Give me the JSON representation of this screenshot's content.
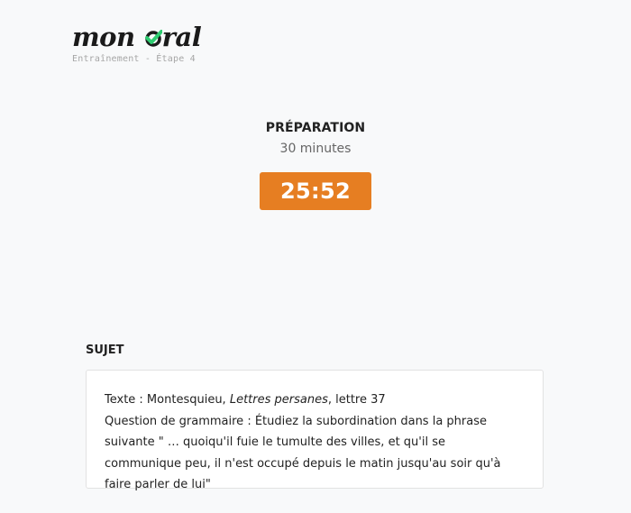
{
  "logo": {
    "word1": "mon",
    "word2_after_check": "ral",
    "check_color": "#2ecc71"
  },
  "header": {
    "subtitle": "Entraînement - Étape 4"
  },
  "timer_section": {
    "phase_title": "PRÉPARATION",
    "phase_duration": "30 minutes",
    "countdown": "25:52",
    "accent_color": "#e67e22"
  },
  "subject": {
    "heading": "SUJET",
    "text_prefix": "Texte : Montesquieu, ",
    "text_work": "Lettres persanes",
    "text_suffix": ", lettre 37",
    "question": "Question de grammaire : Étudiez la subordination dans la phrase suivante \" … quoiqu'il fuie le tumulte des villes, et qu'il se communique peu, il n'est occupé depuis le matin jusqu'au soir qu'à faire parler de lui\""
  }
}
